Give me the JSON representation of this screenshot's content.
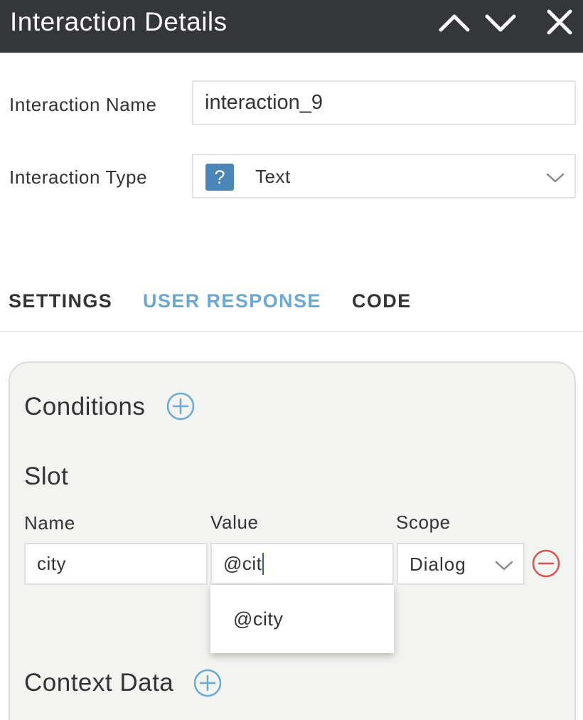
{
  "header": {
    "title": "Interaction Details",
    "prev_icon": "chevron-up-icon",
    "next_icon": "chevron-down-icon",
    "close_icon": "close-icon"
  },
  "form": {
    "name_label": "Interaction Name",
    "name_value": "interaction_9",
    "type_label": "Interaction Type",
    "type_badge": "?",
    "type_value": "Text"
  },
  "tabs": [
    {
      "label": "SETTINGS",
      "active": false
    },
    {
      "label": "USER RESPONSE",
      "active": true
    },
    {
      "label": "CODE",
      "active": false
    }
  ],
  "panel": {
    "conditions_title": "Conditions",
    "slot_title": "Slot",
    "slot": {
      "name_label": "Name",
      "value_label": "Value",
      "scope_label": "Scope",
      "name_value": "city",
      "value_value": "@cit",
      "scope_value": "Dialog"
    },
    "autocomplete": [
      "@city"
    ],
    "context_title": "Context Data"
  },
  "colors": {
    "header_bg": "#35363a",
    "accent": "#6aa9d4",
    "badge": "#4a86b8",
    "remove": "#d9534f",
    "plus": "#6aa9d4",
    "panel_bg": "#f3f3f2"
  }
}
